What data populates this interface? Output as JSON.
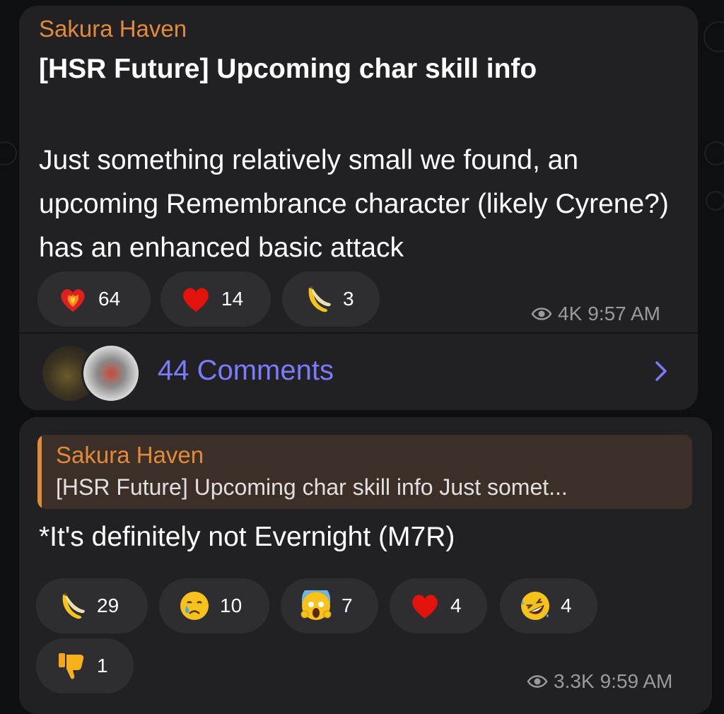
{
  "post": {
    "channel": "Sakura Haven",
    "title": "[HSR Future] Upcoming char skill info",
    "body": "Just something relatively small we found, an upcoming Remembrance character (likely Cyrene?) has an enhanced basic attack",
    "reactions": [
      {
        "icon": "heart-on-fire-icon",
        "count": "64"
      },
      {
        "icon": "red-heart-icon",
        "count": "14"
      },
      {
        "icon": "banana-icon",
        "count": "3"
      }
    ],
    "views": "4K",
    "time": "9:57 AM",
    "comments_label": "44 Comments"
  },
  "reply": {
    "quote_name": "Sakura Haven",
    "quote_text": "[HSR Future] Upcoming char skill info Just somet...",
    "text": "*It's definitely not Evernight (M7R)",
    "reactions": [
      {
        "icon": "banana-icon",
        "count": "29"
      },
      {
        "icon": "crying-face-icon",
        "count": "10"
      },
      {
        "icon": "screaming-face-icon",
        "count": "7"
      },
      {
        "icon": "red-heart-icon",
        "count": "4"
      },
      {
        "icon": "rolling-laughing-face-icon",
        "count": "4"
      },
      {
        "icon": "thumbs-down-icon",
        "count": "1"
      }
    ],
    "views": "3.3K",
    "time": "9:59 AM"
  },
  "colors": {
    "accent": "#e38a3a",
    "link": "#7b7bff",
    "bubble": "#212124",
    "background": "#0e0f11"
  }
}
